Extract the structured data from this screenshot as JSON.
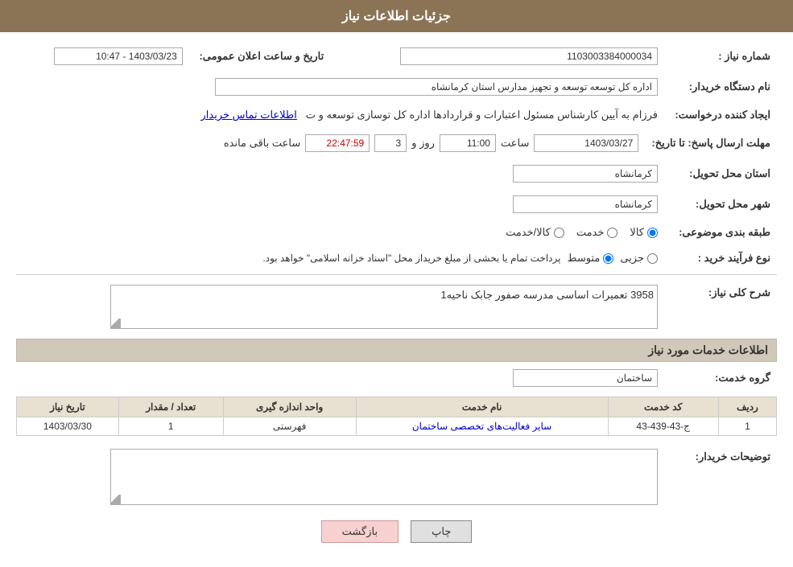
{
  "page": {
    "title": "جزئیات اطلاعات نیاز"
  },
  "header": {
    "title": "جزئیات اطلاعات نیاز"
  },
  "fields": {
    "need_number_label": "شماره نیاز :",
    "need_number_value": "1103003384000034",
    "announcement_date_label": "تاریخ و ساعت اعلان عمومی:",
    "announcement_date_value": "1403/03/23 - 10:47",
    "buyer_org_label": "نام دستگاه خریدار:",
    "buyer_org_value": "اداره کل توسعه  توسعه و تجهیز مدارس استان کرمانشاه",
    "creator_label": "ایجاد کننده درخواست:",
    "creator_value": "فرزام به آیین کارشناس مسئول اعتبارات و قراردادها اداره کل توسازی  توسعه و ت",
    "creator_link": "اطلاعات تماس خریدار",
    "deadline_label": "مهلت ارسال پاسخ: تا تاریخ:",
    "deadline_date": "1403/03/27",
    "deadline_time_label": "ساعت",
    "deadline_time": "11:00",
    "deadline_day_label": "روز و",
    "deadline_days": "3",
    "deadline_seconds": "22:47:59",
    "deadline_remaining_label": "ساعت باقی مانده",
    "province_label": "استان محل تحویل:",
    "province_value": "کرمانشاه",
    "city_label": "شهر محل تحویل:",
    "city_value": "کرمانشاه",
    "category_label": "طبقه بندی موضوعی:",
    "category_options": [
      "کالا",
      "خدمت",
      "کالا/خدمت"
    ],
    "category_selected": "کالا",
    "purchase_type_label": "نوع فرآیند خرید :",
    "purchase_type_options": [
      "جزیی",
      "متوسط"
    ],
    "purchase_type_note": "پرداخت تمام یا بخشی از مبلغ خریداز محل \"اسناد خزانه اسلامی\" خواهد بود.",
    "description_section_title": "شرح کلی نیاز:",
    "description_value": "3958 تعمیرات اساسی مدرسه صفور جابک ناحیه1",
    "services_section_title": "اطلاعات خدمات مورد نیاز",
    "service_group_label": "گروه خدمت:",
    "service_group_value": "ساختمان",
    "services_table": {
      "headers": [
        "ردیف",
        "کد خدمت",
        "نام خدمت",
        "واحد اندازه گیری",
        "تعداد / مقدار",
        "تاریخ نیاز"
      ],
      "rows": [
        {
          "row": "1",
          "code": "ج-43-439-43",
          "name": "سایر فعالیت‌های تخصصی ساختمان",
          "unit": "فهرستی",
          "quantity": "1",
          "date": "1403/03/30"
        }
      ]
    },
    "buyer_notes_label": "توضیحات خریدار:",
    "buyer_notes_value": ""
  },
  "buttons": {
    "print_label": "چاپ",
    "back_label": "بازگشت"
  }
}
